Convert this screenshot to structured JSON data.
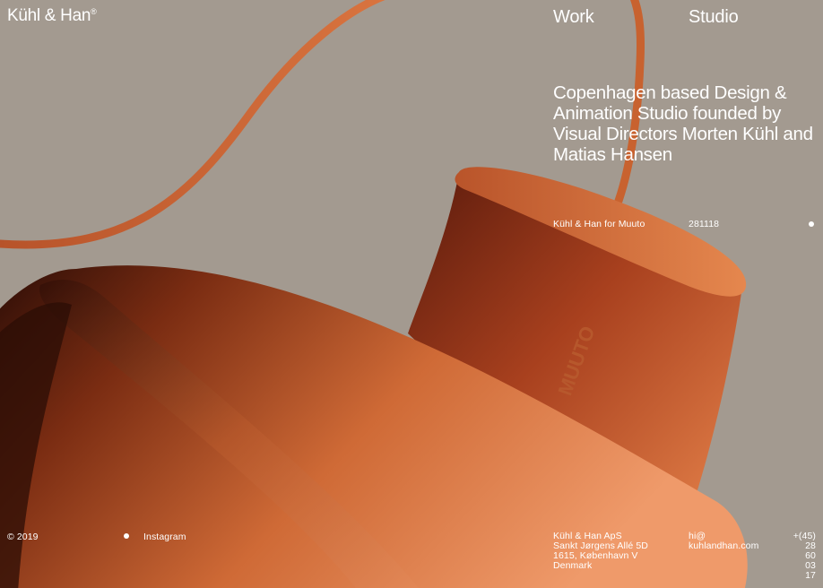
{
  "brand": {
    "name": "Kühl & Han",
    "mark": "®"
  },
  "nav": {
    "work": "Work",
    "studio": "Studio"
  },
  "intro": {
    "tagline": "Copenhagen based Design & Animation Studio founded by Visual Directors Morten Kühl and Matias Hansen"
  },
  "project": {
    "title": "Kühl & Han for Muuto",
    "code": "281118"
  },
  "product": {
    "emboss": "MUUTO"
  },
  "footer": {
    "copyright": "© 2019",
    "instagram": "Instagram",
    "address": [
      "Kühl & Han ApS",
      "Sankt Jørgens Allé 5D",
      "1615, København V",
      "Denmark"
    ],
    "email_user": "hi@",
    "email_domain": "kuhlandhan.com",
    "phone": [
      "+(45)",
      "28",
      "60",
      "03",
      "17"
    ]
  },
  "colors": {
    "background": "#a39a90",
    "lamp_light": "#e07a46",
    "lamp_mid": "#c9622f",
    "lamp_dark": "#3a120a",
    "text": "#ffffff"
  }
}
